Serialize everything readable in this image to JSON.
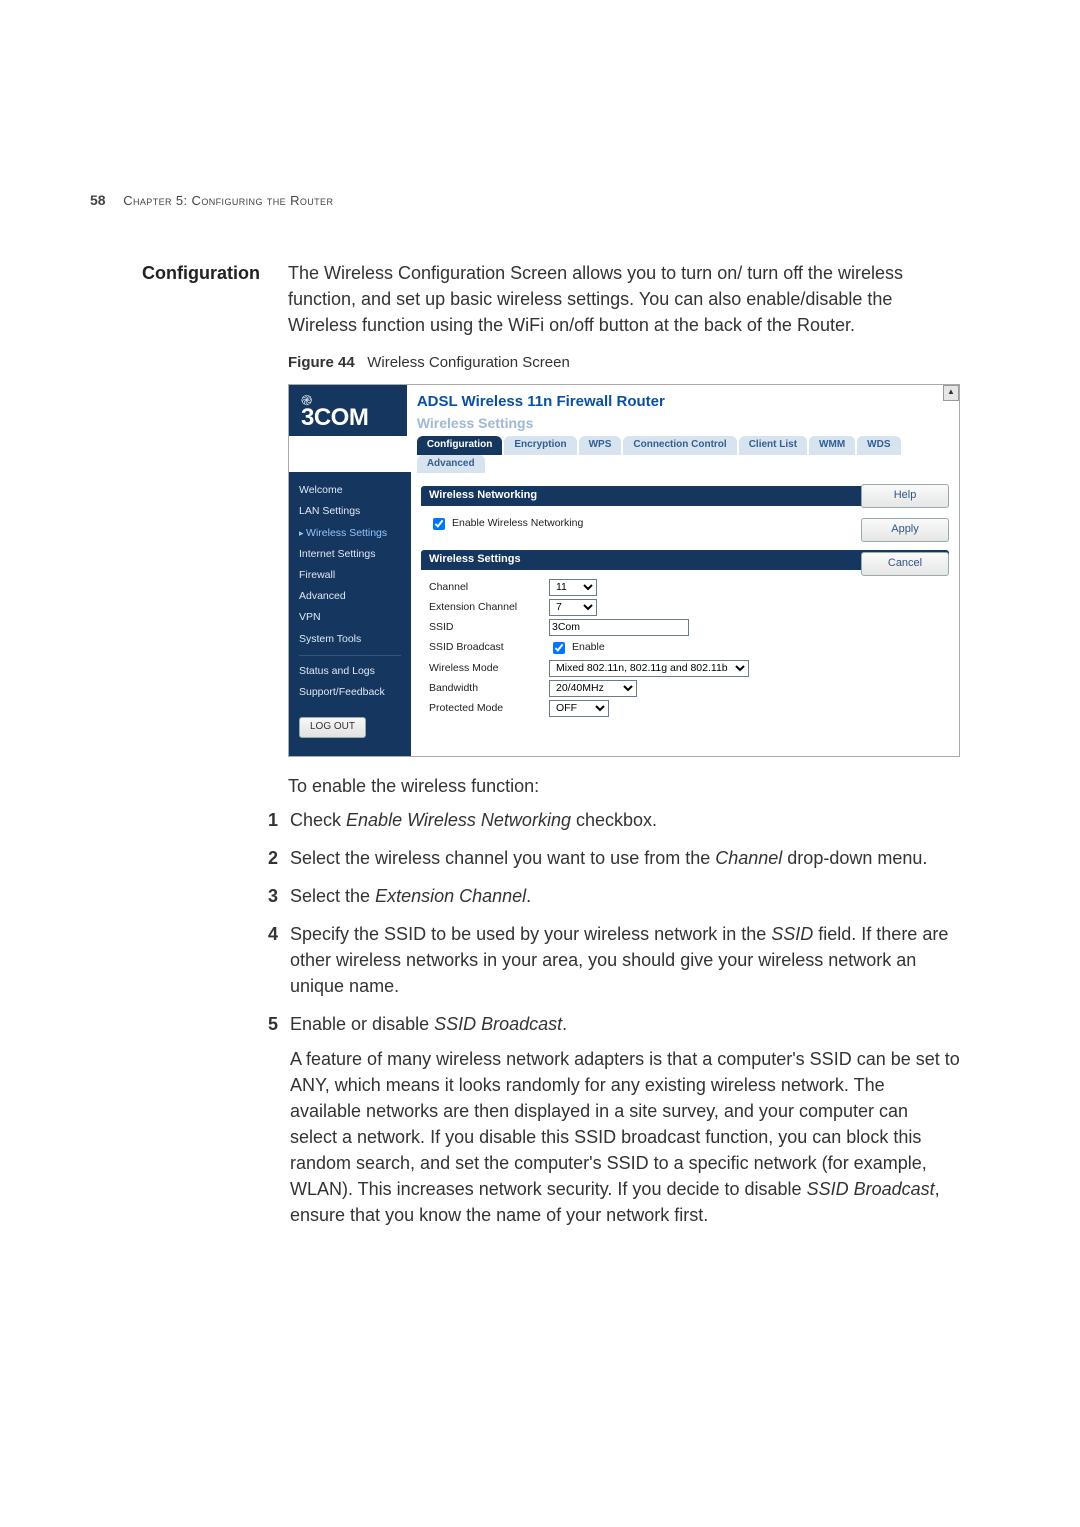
{
  "header": {
    "page_number": "58",
    "chapter_line": "Chapter 5: Configuring the Router"
  },
  "section_heading": "Configuration",
  "intro_paragraph": "The Wireless Configuration Screen allows you to turn on/ turn off the wireless function, and set up basic wireless settings. You can also enable/disable the Wireless function using the WiFi on/off button at the back of the Router.",
  "figure": {
    "label": "Figure 44",
    "caption": "Wireless Configuration Screen"
  },
  "router_ui": {
    "brand": "3COM",
    "title": "ADSL Wireless 11n Firewall Router",
    "subtitle": "Wireless Settings",
    "tabs": [
      "Configuration",
      "Encryption",
      "WPS",
      "Connection Control",
      "Client List",
      "WMM",
      "WDS",
      "Advanced"
    ],
    "active_tab_index": 0,
    "nav": {
      "items_top": [
        "Welcome",
        "LAN Settings",
        "Wireless Settings",
        "Internet Settings",
        "Firewall",
        "Advanced",
        "VPN",
        "System Tools"
      ],
      "current_index": 2,
      "items_bottom": [
        "Status and Logs",
        "Support/Feedback"
      ],
      "logout": "LOG OUT"
    },
    "buttons": {
      "help": "Help",
      "apply": "Apply",
      "cancel": "Cancel"
    },
    "panel1": {
      "title": "Wireless Networking",
      "enable_label": "Enable Wireless Networking",
      "enable_checked": true
    },
    "panel2": {
      "title": "Wireless Settings",
      "rows": {
        "channel_label": "Channel",
        "channel_value": "11",
        "ext_label": "Extension Channel",
        "ext_value": "7",
        "ssid_label": "SSID",
        "ssid_value": "3Com",
        "ssid_bcast_label": "SSID Broadcast",
        "ssid_bcast_enable_label": "Enable",
        "ssid_bcast_checked": true,
        "mode_label": "Wireless Mode",
        "mode_value": "Mixed 802.11n, 802.11g and 802.11b",
        "bw_label": "Bandwidth",
        "bw_value": "20/40MHz",
        "prot_label": "Protected Mode",
        "prot_value": "OFF"
      }
    }
  },
  "lead_text": "To enable the wireless function:",
  "steps": [
    {
      "n": "1",
      "parts": [
        "Check ",
        {
          "em": "Enable Wireless Networking"
        },
        " checkbox."
      ]
    },
    {
      "n": "2",
      "parts": [
        "Select the wireless channel you want to use from the ",
        {
          "em": "Channel"
        },
        " drop-down menu."
      ]
    },
    {
      "n": "3",
      "parts": [
        "Select the ",
        {
          "em": "Extension Channel"
        },
        "."
      ]
    },
    {
      "n": "4",
      "parts": [
        "Specify the SSID to be used by your wireless network in the ",
        {
          "em": "SSID"
        },
        " field. If there are other wireless networks in your area, you should give your wireless network an unique name."
      ]
    },
    {
      "n": "5",
      "parts": [
        "Enable or disable ",
        {
          "em": "SSID Broadcast"
        },
        "."
      ],
      "sub_parts": [
        "A feature of many wireless network adapters is that a computer's SSID can be set to ANY, which means it looks randomly for any existing wireless network. The available networks are then displayed in a site survey, and your computer can select a network. If you disable this SSID broadcast function, you can block this random search, and set the computer's SSID to a specific network (for example, WLAN). This increases network security. If you decide to disable ",
        {
          "em": "SSID Broadcast"
        },
        ", ensure that you know the name of your network first."
      ]
    }
  ]
}
